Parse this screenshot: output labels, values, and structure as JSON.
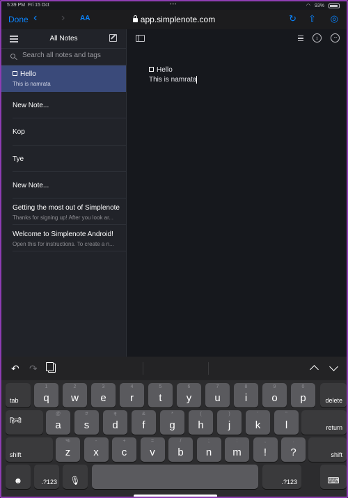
{
  "statusbar": {
    "time": "5:39 PM",
    "date": "Fri 15 Oct",
    "battery": "93%"
  },
  "browser": {
    "done_label": "Done",
    "aa_label": "AA",
    "url": "app.simplenote.com",
    "icons": [
      "back-icon",
      "forward-icon",
      "reload-icon",
      "share-icon",
      "compass-icon",
      "lock-icon"
    ]
  },
  "sidebar": {
    "title": "All Notes",
    "search_placeholder": "Search all notes and tags",
    "notes": [
      {
        "title": "Hello",
        "preview": "This is namrata",
        "selected": true,
        "checkbox": true
      },
      {
        "title": "New Note...",
        "preview": ""
      },
      {
        "title": "Kop",
        "preview": ""
      },
      {
        "title": "Tye",
        "preview": ""
      },
      {
        "title": "New Note...",
        "preview": ""
      },
      {
        "title": "Getting the most out of Simplenote",
        "preview": "Thanks for signing up! After you look ar..."
      },
      {
        "title": "Welcome to Simplenote Android!",
        "preview": "Open this for instructions. To create a n..."
      }
    ]
  },
  "editor": {
    "line1": "Hello",
    "line2": "This is namrata"
  },
  "keyboard": {
    "row1": [
      {
        "main": "q",
        "alt": "1"
      },
      {
        "main": "w",
        "alt": "2"
      },
      {
        "main": "e",
        "alt": "3"
      },
      {
        "main": "r",
        "alt": "4"
      },
      {
        "main": "t",
        "alt": "5"
      },
      {
        "main": "y",
        "alt": "6"
      },
      {
        "main": "u",
        "alt": "7"
      },
      {
        "main": "i",
        "alt": "8"
      },
      {
        "main": "o",
        "alt": "9"
      },
      {
        "main": "p",
        "alt": "0"
      }
    ],
    "row2": [
      {
        "main": "a",
        "alt": "@"
      },
      {
        "main": "s",
        "alt": "#"
      },
      {
        "main": "d",
        "alt": "₹"
      },
      {
        "main": "f",
        "alt": "&"
      },
      {
        "main": "g",
        "alt": "*"
      },
      {
        "main": "h",
        "alt": "("
      },
      {
        "main": "j",
        "alt": ")"
      },
      {
        "main": "k",
        "alt": "'"
      },
      {
        "main": "l",
        "alt": "\""
      }
    ],
    "row3": [
      {
        "main": "z",
        "alt": "%"
      },
      {
        "main": "x",
        "alt": "-"
      },
      {
        "main": "c",
        "alt": "+"
      },
      {
        "main": "v",
        "alt": "="
      },
      {
        "main": "b",
        "alt": "/"
      },
      {
        "main": "n",
        "alt": ";"
      },
      {
        "main": "m",
        "alt": ":"
      },
      {
        "main": "!",
        "alt": ","
      },
      {
        "main": "?",
        "alt": "."
      }
    ],
    "tab": "tab",
    "delete": "delete",
    "lang": "हिन्दी",
    "return": "return",
    "shift": "shift",
    "num": ".?123"
  }
}
